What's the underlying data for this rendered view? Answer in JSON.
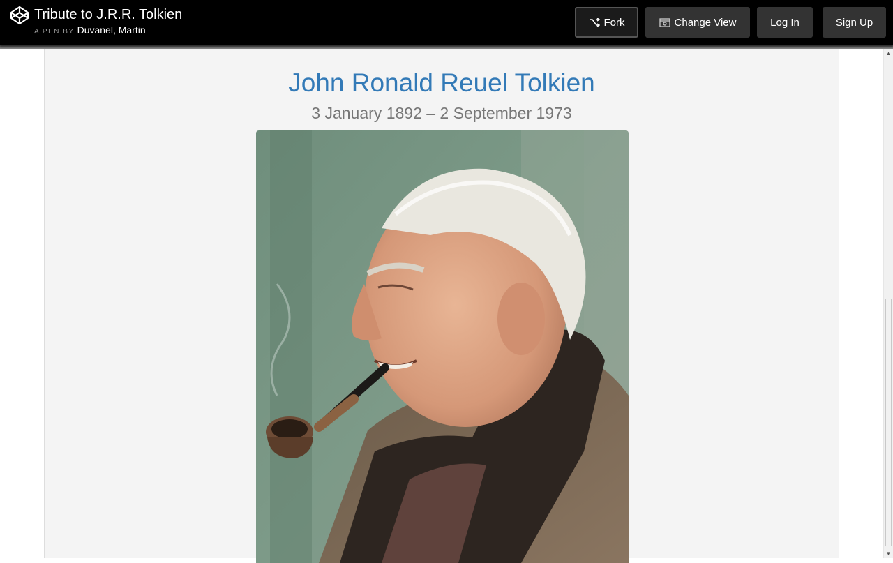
{
  "header": {
    "title": "Tribute to J.R.R. Tolkien",
    "by_prefix": "A PEN BY",
    "author": "Duvanel, Martin",
    "logo_icon": "codepen-logo-icon",
    "buttons": {
      "fork": "Fork",
      "change_view": "Change View",
      "login": "Log In",
      "signup": "Sign Up"
    }
  },
  "tribute": {
    "name": "John Ronald Reuel Tolkien",
    "dates": "3 January 1892 – 2 September 1973",
    "name_color": "#337ab7"
  }
}
